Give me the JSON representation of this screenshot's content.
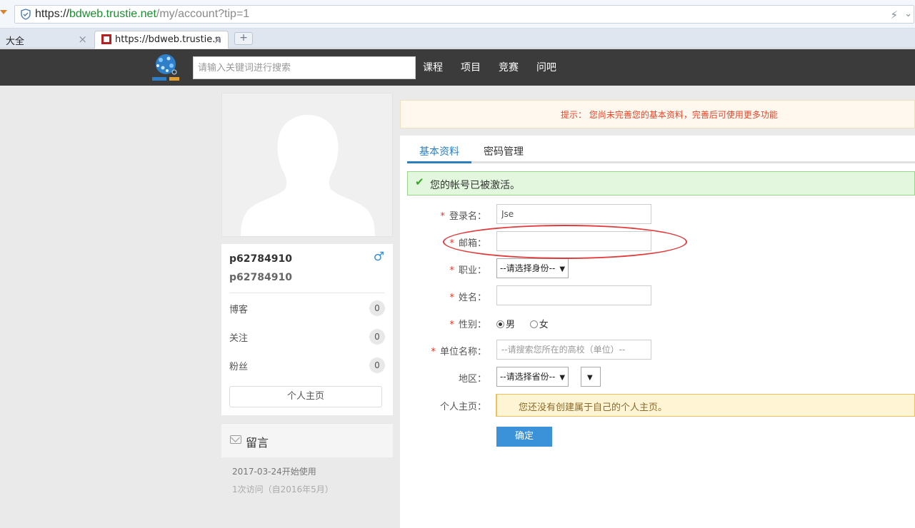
{
  "browser": {
    "url_scheme": "https://",
    "url_host": "bdweb.trustie.net",
    "url_path": "/my/account?tip=1",
    "tabs": [
      {
        "label": "大全"
      },
      {
        "label": "https://bdweb.trustie.n"
      }
    ],
    "new_tab_label": "+"
  },
  "header": {
    "search_placeholder": "请输入关键词进行搜索",
    "nav": [
      "课程",
      "项目",
      "竞赛",
      "问吧"
    ]
  },
  "profile": {
    "name": "p62784910",
    "login": "p62784910",
    "stats": [
      {
        "label": "博客",
        "count": "0"
      },
      {
        "label": "关注",
        "count": "0"
      },
      {
        "label": "粉丝",
        "count": "0"
      }
    ],
    "homepage_button": "个人主页",
    "message_title": "留言",
    "since": "2017-03-24开始使用",
    "visits": "1次访问（自2016年5月）"
  },
  "tip": "提示： 您尚未完善您的基本资料，完善后可使用更多功能",
  "tabs": {
    "basic": "基本资料",
    "password": "密码管理"
  },
  "success_message": "您的帐号已被激活。",
  "form": {
    "required_mark": "*",
    "login_label": "登录名：",
    "login_value": "Jse",
    "email_label": "邮箱：",
    "email_value": "",
    "job_label": "职业：",
    "job_select": "--请选择身份--",
    "realname_label": "姓名：",
    "realname_value": "",
    "gender_label": "性别：",
    "gender_male": "男",
    "gender_female": "女",
    "org_label": "单位名称：",
    "org_placeholder": "--请搜索您所在的高校（单位）--",
    "region_label": "地区：",
    "region_select": "--请选择省份--",
    "city_select": "",
    "homepage_label": "个人主页：",
    "homepage_note": "您还没有创建属于自己的个人主页。",
    "confirm": "确定"
  },
  "colors": {
    "accent": "#3b92d9",
    "header_bg": "#3b3b3b",
    "annotation": "#e23a3a"
  }
}
